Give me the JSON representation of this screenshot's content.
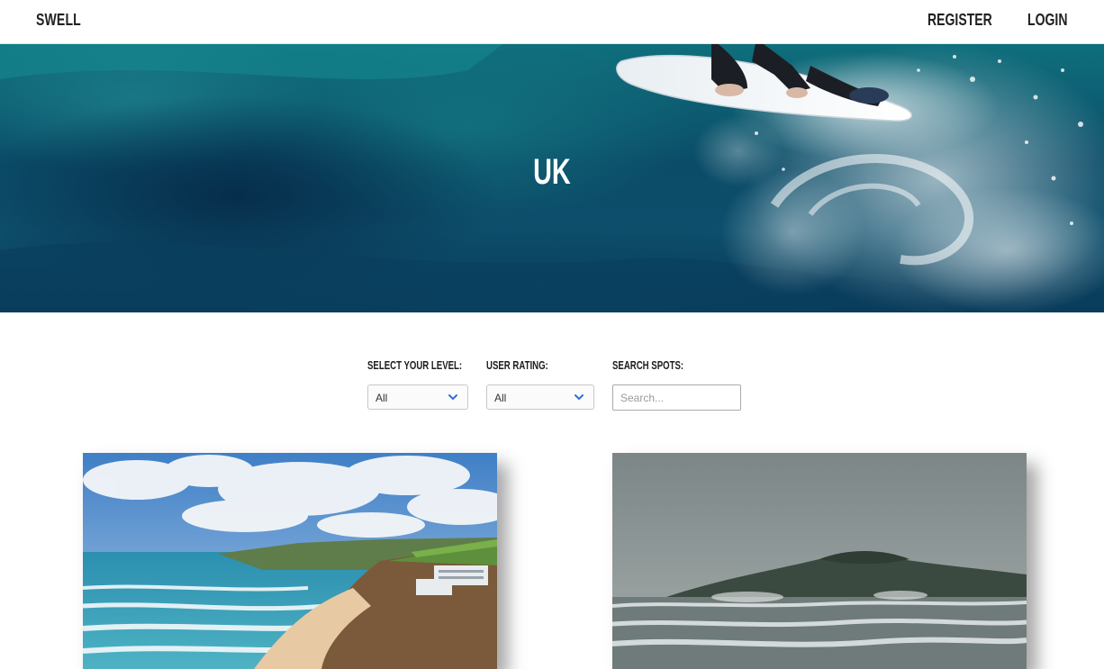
{
  "nav": {
    "brand": "SWELL",
    "register": "REGISTER",
    "login": "LOGIN"
  },
  "hero": {
    "title": "UK"
  },
  "filters": {
    "level": {
      "label": "SELECT YOUR LEVEL:",
      "value": "All"
    },
    "rating": {
      "label": "USER RATING:",
      "value": "All"
    },
    "search": {
      "label": "SEARCH SPOTS:",
      "placeholder": "Search..."
    }
  },
  "icons": {
    "chevron": "chevron-down-icon"
  },
  "colors": {
    "accent": "#2f6fd6",
    "nav_text": "#222222",
    "hero_text": "#ffffff"
  }
}
